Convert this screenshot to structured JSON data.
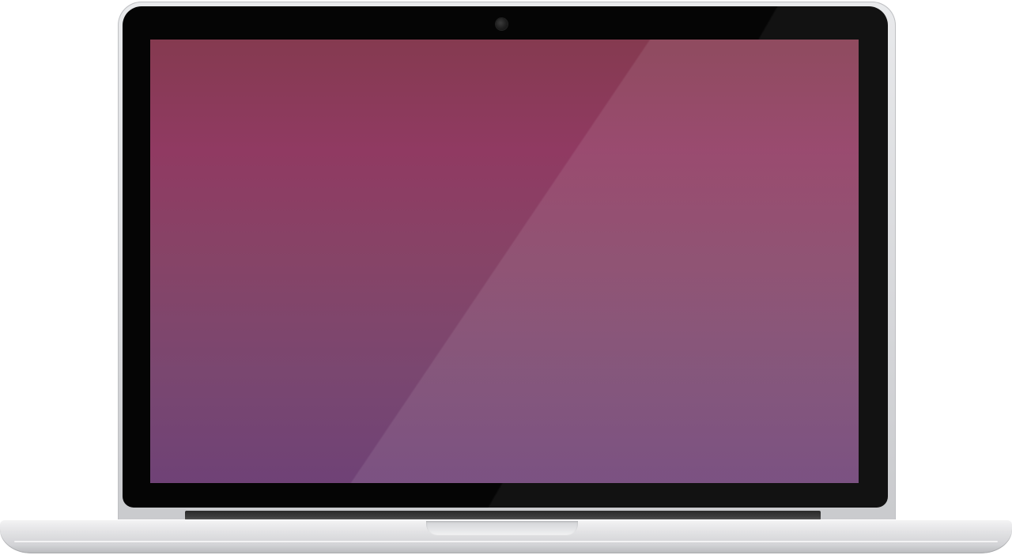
{
  "device": {
    "type": "laptop",
    "screen_state": "blank-wallpaper",
    "colors": {
      "lid": "#dcdddf",
      "bezel": "#050505",
      "screen_top": "#853a50",
      "screen_middle": "#864467",
      "screen_bottom": "#6f4276",
      "base": "#e3e3e5"
    },
    "icons": [
      "camera-icon"
    ]
  }
}
